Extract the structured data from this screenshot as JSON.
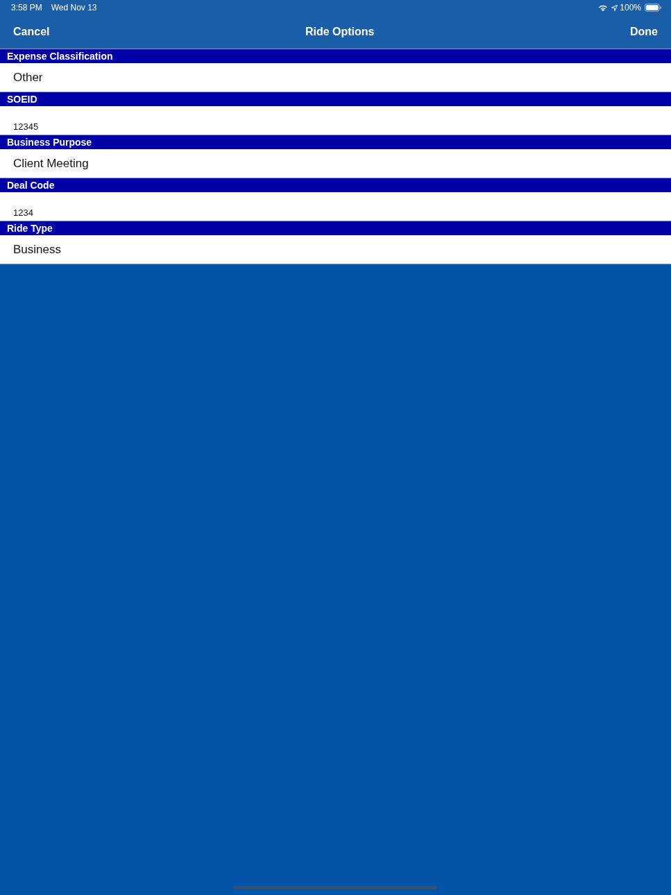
{
  "status_bar": {
    "time": "3:58 PM",
    "date": "Wed Nov 13",
    "battery": "100%"
  },
  "nav_bar": {
    "cancel": "Cancel",
    "title": "Ride Options",
    "done": "Done"
  },
  "sections": [
    {
      "header": "Expense Classification",
      "kind": "select",
      "value": "Other"
    },
    {
      "header": "SOEID",
      "kind": "input",
      "value": "12345"
    },
    {
      "header": "Business Purpose",
      "kind": "select",
      "value": "Client Meeting"
    },
    {
      "header": "Deal Code",
      "kind": "input",
      "value": "1234"
    },
    {
      "header": "Ride Type",
      "kind": "select",
      "value": "Business"
    }
  ]
}
